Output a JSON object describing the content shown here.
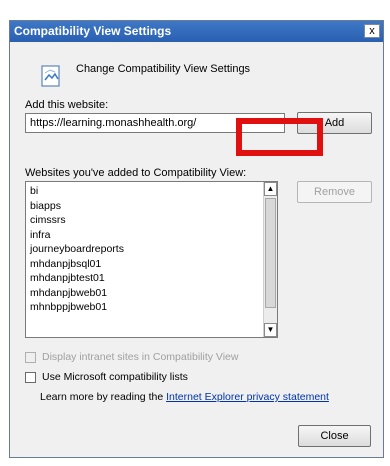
{
  "window": {
    "title": "Compatibility View Settings",
    "close_glyph": "x"
  },
  "header": {
    "icon": "compat-view-page-icon",
    "text": "Change Compatibility View Settings"
  },
  "add_site": {
    "label": "Add this website:",
    "value": "https://learning.monashhealth.org/",
    "add_button": "Add",
    "highlight_color": "#e01010"
  },
  "sites": {
    "label": "Websites you've added to Compatibility View:",
    "items": [
      "bi",
      "biapps",
      "cimssrs",
      "infra",
      "journeyboardreports",
      "mhdanpjbsql01",
      "mhdanpjbtest01",
      "mhdanpjbweb01",
      "mhnbppjbweb01"
    ],
    "remove_button": "Remove"
  },
  "options": {
    "intranet_label": "Display intranet sites in Compatibility View",
    "intranet_checked": false,
    "ms_lists_label": "Use Microsoft compatibility lists",
    "ms_lists_checked": false
  },
  "learn_more": {
    "prefix": "Learn more by reading the",
    "link": "Internet Explorer privacy statement"
  },
  "footer": {
    "close_button": "Close"
  }
}
